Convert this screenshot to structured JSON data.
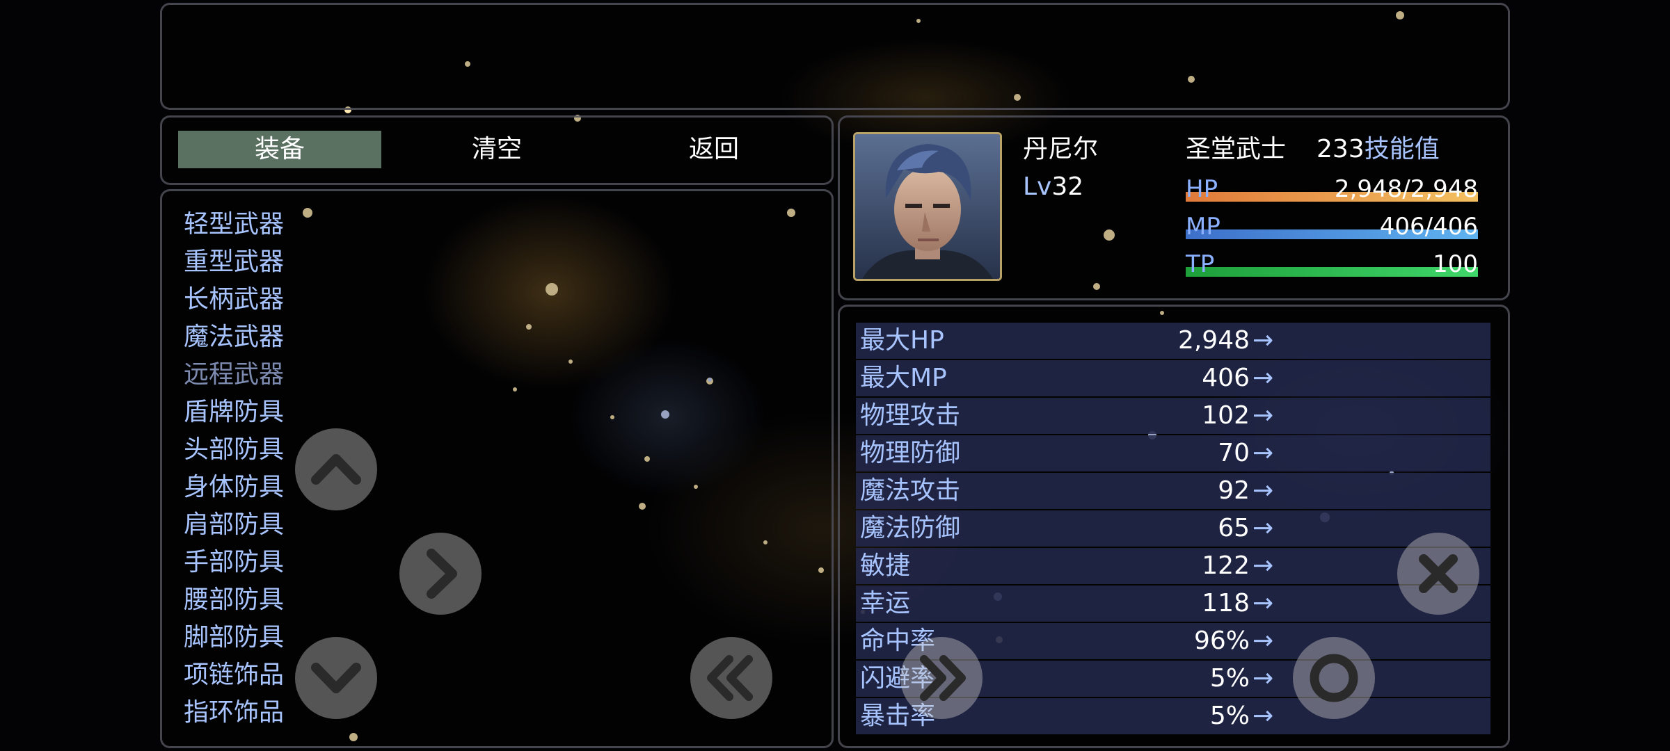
{
  "colors": {
    "hp_gauge_start": "#e07a3a",
    "hp_gauge_end": "#f3c060",
    "mp_gauge_start": "#3d6fc9",
    "mp_gauge_end": "#5fb3f0",
    "tp_gauge_start": "#1e9f3a",
    "tp_gauge_end": "#3fd66a",
    "system_text": "#a8c4ff",
    "selected_command": "#7aa08a"
  },
  "help_window": {
    "text": ""
  },
  "commands": {
    "equip_label": "装备",
    "clear_label": "清空",
    "back_label": "返回"
  },
  "slots": [
    {
      "label": "轻型武器"
    },
    {
      "label": "重型武器"
    },
    {
      "label": "长柄武器"
    },
    {
      "label": "魔法武器"
    },
    {
      "label": "远程武器"
    },
    {
      "label": "盾牌防具"
    },
    {
      "label": "头部防具"
    },
    {
      "label": "身体防具"
    },
    {
      "label": "肩部防具"
    },
    {
      "label": "手部防具"
    },
    {
      "label": "腰部防具"
    },
    {
      "label": "脚部防具"
    },
    {
      "label": "项链饰品"
    },
    {
      "label": "指环饰品"
    }
  ],
  "actor": {
    "name": "丹尼尔",
    "class": "圣堂武士",
    "level_label": "Lv",
    "level": "32",
    "skill_points": "233",
    "skill_points_label": "技能值",
    "face_icon": "portrait-man-blue-hair",
    "gauges": {
      "hp": {
        "label": "HP",
        "value": "2,948/2,948",
        "fill": 1.0
      },
      "mp": {
        "label": "MP",
        "value": "406/406",
        "fill": 1.0
      },
      "tp": {
        "label": "TP",
        "value": "100",
        "fill": 1.0
      }
    }
  },
  "stats": [
    {
      "name": "最大HP",
      "value": "2,948",
      "arrow": "→"
    },
    {
      "name": "最大MP",
      "value": "406",
      "arrow": "→"
    },
    {
      "name": "物理攻击",
      "value": "102",
      "arrow": "→"
    },
    {
      "name": "物理防御",
      "value": "70",
      "arrow": "→"
    },
    {
      "name": "魔法攻击",
      "value": "92",
      "arrow": "→"
    },
    {
      "name": "魔法防御",
      "value": "65",
      "arrow": "→"
    },
    {
      "name": "敏捷",
      "value": "122",
      "arrow": "→"
    },
    {
      "name": "幸运",
      "value": "118",
      "arrow": "→"
    },
    {
      "name": "命中率",
      "value": "96%",
      "arrow": "→"
    },
    {
      "name": "闪避率",
      "value": "5%",
      "arrow": "→"
    },
    {
      "name": "暴击率",
      "value": "5%",
      "arrow": "→"
    }
  ],
  "touch_controls": {
    "up_icon": "chevron-up-icon",
    "down_icon": "chevron-down-icon",
    "right_icon": "chevron-right-icon",
    "double_left_icon": "double-chevron-left-icon",
    "double_right_icon": "double-chevron-right-icon",
    "cancel_icon": "close-icon",
    "ok_icon": "circle-ok-icon"
  }
}
